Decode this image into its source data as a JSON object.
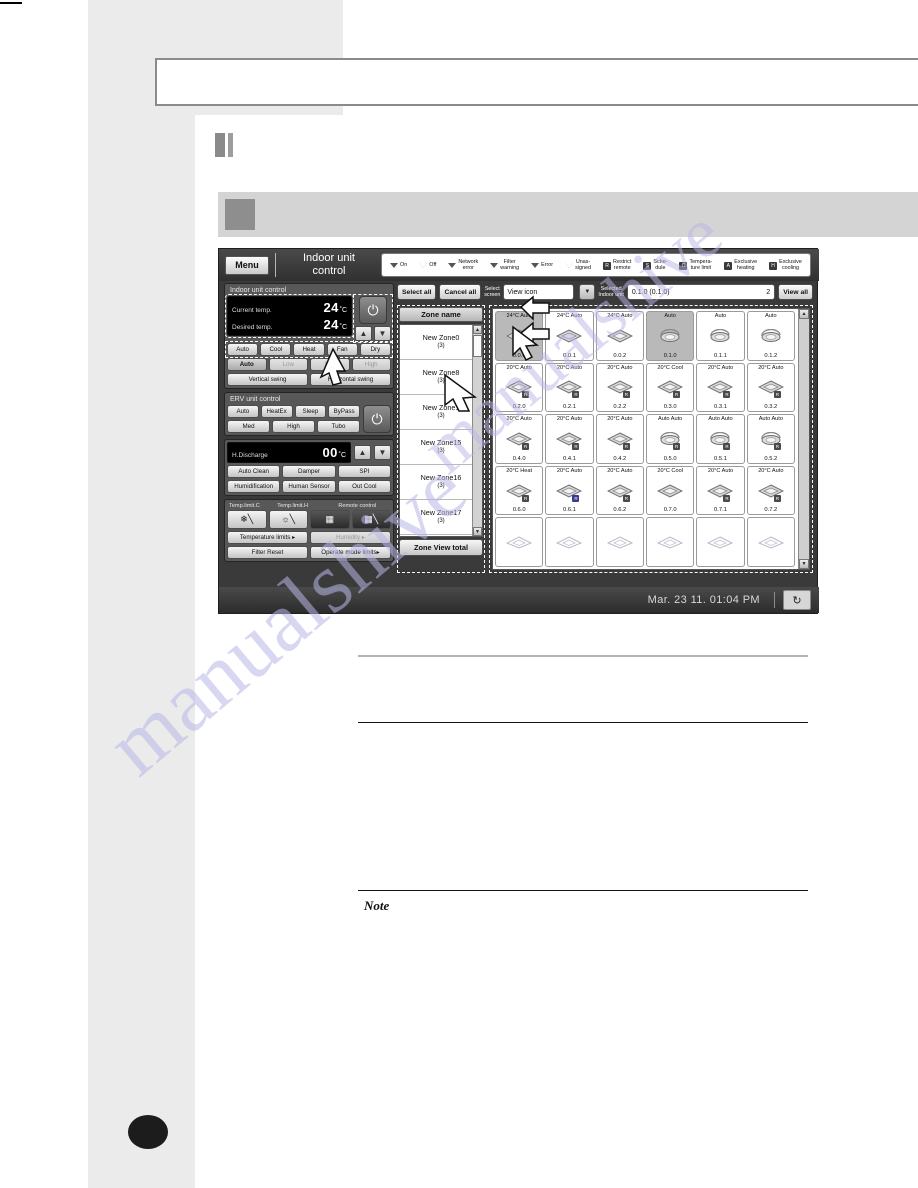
{
  "device": {
    "menu_button": "Menu",
    "app_title_line1": "Indoor unit",
    "app_title_line2": "control",
    "legend": [
      {
        "glyph": "arrow-filled",
        "label": "On"
      },
      {
        "glyph": "arrow-outline",
        "label": "Off"
      },
      {
        "glyph": "arrow-filled",
        "label": "Network\nerror"
      },
      {
        "glyph": "arrow-filled",
        "label": "Filter\nwarning"
      },
      {
        "glyph": "arrow-filled",
        "label": "Error"
      },
      {
        "glyph": "arrow-outline",
        "label": "Unas-\nsigned"
      },
      {
        "glyph": "box-R",
        "label": "Restrict\nremote"
      },
      {
        "glyph": "box-S",
        "label": "Sche-\ndule"
      },
      {
        "glyph": "box-C",
        "label": "Tempera-\nture limit"
      },
      {
        "glyph": "box-A",
        "label": "Exclusive\nheating"
      },
      {
        "glyph": "box-H",
        "label": "Exclusive\ncooling"
      }
    ],
    "indoor_panel": {
      "title": "Indoor unit control",
      "current_temp_label": "Current temp.",
      "current_temp_value": "24",
      "desired_temp_label": "Desired temp.",
      "desired_temp_value": "24",
      "unit": "˚C",
      "power_icon": "power-icon",
      "up_icon": "chevron-up-icon",
      "down_icon": "chevron-down-icon",
      "modes": [
        "Auto",
        "Cool",
        "Heat",
        "Fan",
        "Dry"
      ],
      "fan_speeds": [
        "Auto",
        "Low",
        "Mid",
        "High"
      ],
      "fan_speed_active": "Auto",
      "swing": [
        "Vertical swing",
        "Horizontal swing"
      ]
    },
    "erv_panel": {
      "title": "ERV unit control",
      "row1": [
        "Auto",
        "HeatEx",
        "Sleep",
        "ByPass"
      ],
      "row2": [
        "Med",
        "High",
        "Tubo"
      ],
      "power_icon": "power-icon"
    },
    "discharge_panel": {
      "label": "H.Discharge",
      "value": "00",
      "unit": "˚C",
      "up_icon": "chevron-up-icon",
      "down_icon": "chevron-down-icon",
      "row1": [
        "Auto Clean",
        "Damper",
        "SPI"
      ],
      "row2": [
        "Humidification",
        "Human Sensor",
        "Out Cool"
      ]
    },
    "limits_panel": {
      "header_cool": "Temp.limit.C",
      "header_heat": "Temp.limit.H",
      "header_remote": "Remote control",
      "icons": [
        "snowflake-limit-icon",
        "sun-limit-icon",
        "remote-enabled-icon",
        "remote-disabled-icon"
      ],
      "buttons": [
        "Temperature limits ▸",
        "Humidity ▸",
        "Filter Reset",
        "Operate mode limits▸"
      ],
      "disabled": [
        "Humidity ▸"
      ]
    },
    "toolbar": {
      "select_all": "Select all",
      "cancel_all": "Cancel all",
      "select_screen_label": "Select\nscreen",
      "view_mode": "View icon",
      "dropdown_icon": "chevron-down-icon",
      "selected_unit_label": "Selected\nIndoor unit",
      "selected_unit_value": "0.1.0 (0.1.0)",
      "selected_unit_count": "2",
      "view_all": "View all"
    },
    "zone_panel": {
      "header": "Zone name",
      "items": [
        {
          "name": "New Zone0",
          "count": "(3)"
        },
        {
          "name": "New Zone8",
          "count": "(3)"
        },
        {
          "name": "New Zone1",
          "count": "(3)"
        },
        {
          "name": "New Zone15",
          "count": "(3)"
        },
        {
          "name": "New Zone16",
          "count": "(3)"
        },
        {
          "name": "New Zone17",
          "count": "(3)"
        }
      ],
      "scroll_up_icon": "scroll-up-icon",
      "scroll_down_icon": "scroll-down-icon",
      "total_button": "Zone View total"
    },
    "grid": {
      "scroll_up_icon": "scroll-up-icon",
      "scroll_down_icon": "scroll-down-icon",
      "cells": [
        {
          "top": "24°C Auto",
          "id": "0.0.0",
          "icon": "cassette-icon",
          "selected": true,
          "badge": ""
        },
        {
          "top": "24°C Auto",
          "id": "0.0.1",
          "icon": "cassette-icon",
          "selected": false,
          "badge": ""
        },
        {
          "top": "24°C Auto",
          "id": "0.0.2",
          "icon": "cassette-icon",
          "selected": false,
          "badge": ""
        },
        {
          "top": "Auto",
          "id": "0.1.0",
          "icon": "erv-icon",
          "selected": true,
          "badge": ""
        },
        {
          "top": "Auto",
          "id": "0.1.1",
          "icon": "erv-icon",
          "selected": false,
          "badge": ""
        },
        {
          "top": "Auto",
          "id": "0.1.2",
          "icon": "erv-icon",
          "selected": false,
          "badge": ""
        },
        {
          "top": "20°C Auto",
          "id": "0.2.0",
          "icon": "cassette-icon",
          "selected": false,
          "badge": "R"
        },
        {
          "top": "20°C Auto",
          "id": "0.2.1",
          "icon": "cassette-icon",
          "selected": false,
          "badge": "R"
        },
        {
          "top": "20°C Auto",
          "id": "0.2.2",
          "icon": "cassette-icon",
          "selected": false,
          "badge": "R"
        },
        {
          "top": "20°C Cool",
          "id": "0.3.0",
          "icon": "cassette-icon",
          "selected": false,
          "badge": "R"
        },
        {
          "top": "20°C Auto",
          "id": "0.3.1",
          "icon": "cassette-icon",
          "selected": false,
          "badge": "R"
        },
        {
          "top": "20°C Auto",
          "id": "0.3.2",
          "icon": "cassette-icon",
          "selected": false,
          "badge": "R"
        },
        {
          "top": "20°C Auto",
          "id": "0.4.0",
          "icon": "cassette-icon",
          "selected": false,
          "badge": "R"
        },
        {
          "top": "20°C Auto",
          "id": "0.4.1",
          "icon": "cassette-icon",
          "selected": false,
          "badge": "R"
        },
        {
          "top": "20°C Auto",
          "id": "0.4.2",
          "icon": "cassette-icon",
          "selected": false,
          "badge": "R"
        },
        {
          "top": "Auto Auto",
          "id": "0.5.0",
          "icon": "erv-icon",
          "selected": false,
          "badge": "R"
        },
        {
          "top": "Auto Auto",
          "id": "0.5.1",
          "icon": "erv-icon",
          "selected": false,
          "badge": "R"
        },
        {
          "top": "Auto Auto",
          "id": "0.5.2",
          "icon": "erv-icon",
          "selected": false,
          "badge": "R"
        },
        {
          "top": "20°C Heat",
          "id": "0.6.0",
          "icon": "cassette-icon",
          "selected": false,
          "badge": "R"
        },
        {
          "top": "20°C Auto",
          "id": "0.6.1",
          "icon": "cassette-icon",
          "selected": false,
          "badge": "R"
        },
        {
          "top": "20°C Auto",
          "id": "0.6.2",
          "icon": "cassette-icon",
          "selected": false,
          "badge": "R"
        },
        {
          "top": "20°C Cool",
          "id": "0.7.0",
          "icon": "cassette-icon",
          "selected": false,
          "badge": ""
        },
        {
          "top": "20°C Auto",
          "id": "0.7.1",
          "icon": "cassette-icon",
          "selected": false,
          "badge": "R"
        },
        {
          "top": "20°C Auto",
          "id": "0.7.2",
          "icon": "cassette-icon",
          "selected": false,
          "badge": "R"
        },
        {
          "top": "",
          "id": "",
          "icon": "cassette-icon",
          "selected": false,
          "badge": ""
        },
        {
          "top": "",
          "id": "",
          "icon": "cassette-icon",
          "selected": false,
          "badge": ""
        },
        {
          "top": "",
          "id": "",
          "icon": "cassette-icon",
          "selected": false,
          "badge": ""
        },
        {
          "top": "",
          "id": "",
          "icon": "cassette-icon",
          "selected": false,
          "badge": ""
        },
        {
          "top": "",
          "id": "",
          "icon": "cassette-icon",
          "selected": false,
          "badge": ""
        },
        {
          "top": "",
          "id": "",
          "icon": "cassette-icon",
          "selected": false,
          "badge": ""
        }
      ]
    },
    "status_bar": {
      "clock": "Mar. 23 11. 01:04 PM",
      "refresh_icon": "refresh-icon"
    }
  },
  "document": {
    "note_label": "Note",
    "watermark": "manualshive"
  },
  "colors": {
    "device_frame": "#3a3a3a",
    "panel": "#585858",
    "lcd": "#000000",
    "selected_cell": "#b9b9b9",
    "page_band": "#ebebeb",
    "banner": "#d4d4d4"
  }
}
